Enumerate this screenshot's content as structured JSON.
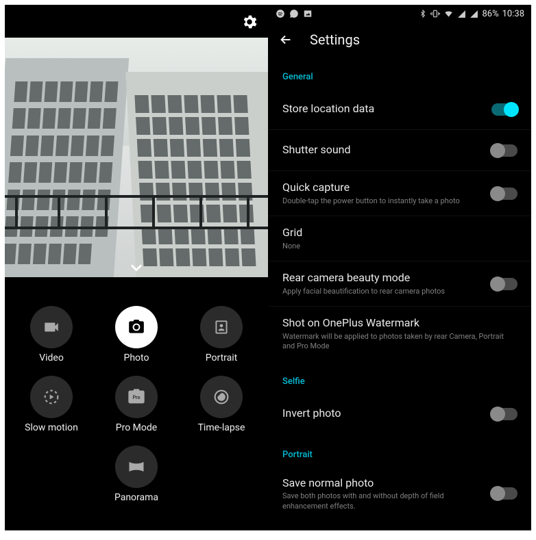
{
  "statusbar": {
    "battery_pct": "86%",
    "time": "10:38"
  },
  "camera": {
    "modes": [
      {
        "key": "video",
        "label": "Video"
      },
      {
        "key": "photo",
        "label": "Photo",
        "active": true
      },
      {
        "key": "portrait",
        "label": "Portrait"
      },
      {
        "key": "slowmo",
        "label": "Slow motion"
      },
      {
        "key": "pro",
        "label": "Pro Mode"
      },
      {
        "key": "timelapse",
        "label": "Time-lapse"
      },
      {
        "key": "panorama",
        "label": "Panorama"
      }
    ]
  },
  "settings": {
    "title": "Settings",
    "sections": {
      "general": {
        "header": "General",
        "store_location": {
          "title": "Store location data",
          "on": true
        },
        "shutter_sound": {
          "title": "Shutter sound",
          "on": false
        },
        "quick_capture": {
          "title": "Quick capture",
          "sub": "Double-tap the power button to instantly take a photo",
          "on": false
        },
        "grid": {
          "title": "Grid",
          "sub": "None"
        },
        "beauty": {
          "title": "Rear camera beauty mode",
          "sub": "Apply facial beautification to rear camera photos",
          "on": false
        },
        "watermark": {
          "title": "Shot on OnePlus Watermark",
          "sub": "Watermark will be applied to photos taken by rear Camera, Portrait and Pro Mode"
        }
      },
      "selfie": {
        "header": "Selfie",
        "invert": {
          "title": "Invert photo",
          "on": false
        }
      },
      "portrait": {
        "header": "Portrait",
        "save_normal": {
          "title": "Save normal photo",
          "sub": "Save both photos with and without depth of field enhancement effects.",
          "on": false
        }
      }
    }
  }
}
